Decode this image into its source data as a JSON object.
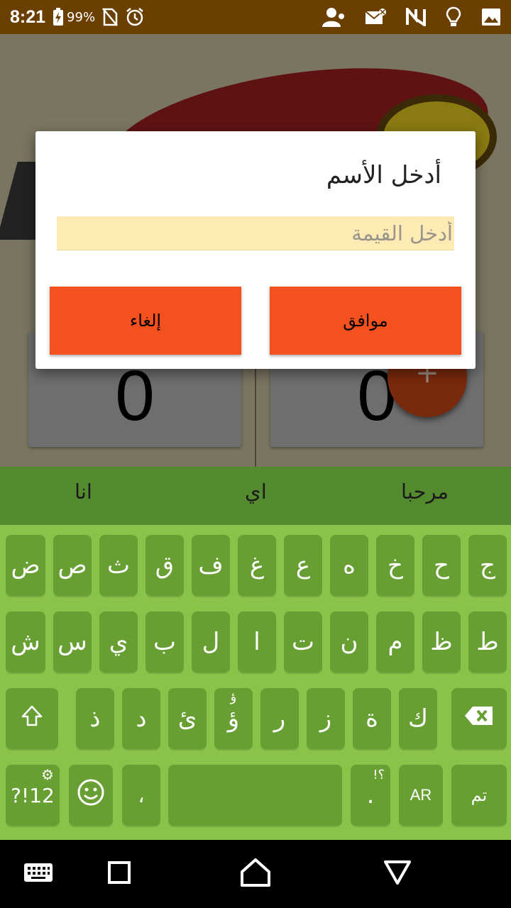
{
  "status_bar": {
    "time": "8:21",
    "battery": "99%",
    "icons": [
      "battery-charging-icon",
      "no-sim-icon",
      "alarm-icon",
      "user-icon",
      "email-icon",
      "n-icon",
      "lightbulb-icon",
      "image-icon"
    ]
  },
  "app": {
    "score_left": "0",
    "score_right": "0",
    "fab_label": "+"
  },
  "dialog": {
    "title": "أدخل الأسم",
    "input_placeholder": "أدخل القيمة",
    "input_value": "",
    "cancel_label": "إلغاء",
    "ok_label": "موافق"
  },
  "suggestions": [
    "مرحبا",
    "اي",
    "انا"
  ],
  "keyboard": {
    "row1": [
      "ج",
      "ح",
      "خ",
      "ه",
      "ع",
      "غ",
      "ف",
      "ق",
      "ث",
      "ص",
      "ض"
    ],
    "row2": [
      "ط",
      "ظ",
      "م",
      "ن",
      "ت",
      "ا",
      "ل",
      "ب",
      "ي",
      "س",
      "ش"
    ],
    "row3": [
      "ك",
      "ة",
      "ز",
      "ر",
      "ؤ",
      "ئ",
      "د",
      "ذ"
    ],
    "row3_hint_key": "ؤ",
    "row3_hint": "ؤ",
    "symbols_label": "?!12",
    "comma_label": "،",
    "period_label": ".",
    "period_hint": "!؟",
    "lang_label": "AR",
    "done_label": "تم"
  },
  "colors": {
    "status_bar": "#6b3f00",
    "accent_button": "#f5511e",
    "keyboard_bg": "#8bc34a",
    "key_bg": "#679f33",
    "suggestion_bg": "#558b2f",
    "input_bg": "#fdebb3"
  }
}
